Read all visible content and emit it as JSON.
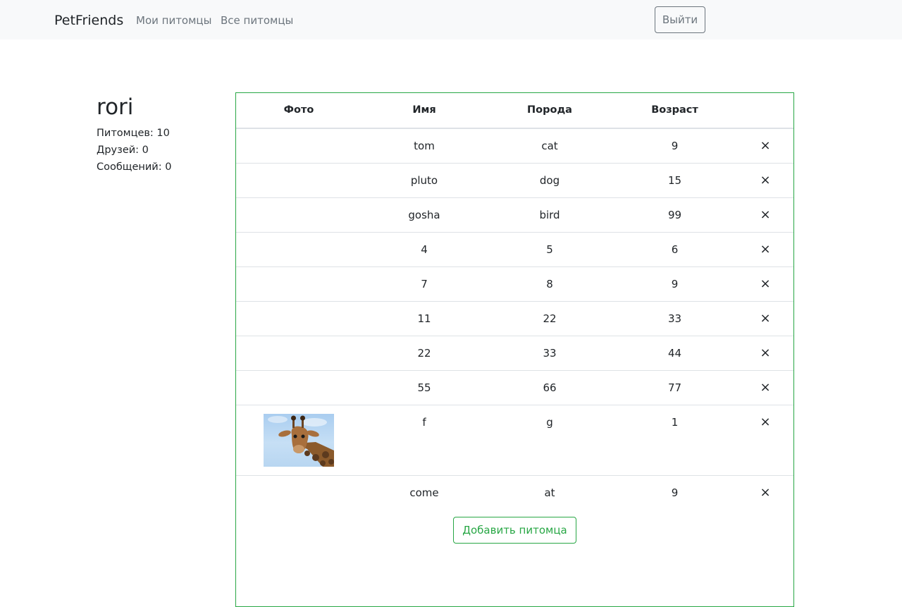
{
  "navbar": {
    "brand": "PetFriends",
    "links": [
      "Мои питомцы",
      "Все питомцы"
    ],
    "logout_label": "Выйти"
  },
  "profile": {
    "username": "rori",
    "pets_count": "Питомцев: 10",
    "friends_count": "Друзей: 0",
    "messages_count": "Сообщений: 0"
  },
  "table": {
    "headers": [
      "Фото",
      "Имя",
      "Порода",
      "Возраст",
      ""
    ],
    "rows": [
      {
        "name": "tom",
        "breed": "cat",
        "age": "9",
        "delete": "×"
      },
      {
        "name": "pluto",
        "breed": "dog",
        "age": "15",
        "delete": "×"
      },
      {
        "name": "gosha",
        "breed": "bird",
        "age": "99",
        "delete": "×"
      },
      {
        "name": "4",
        "breed": "5",
        "age": "6",
        "delete": "×"
      },
      {
        "name": "7",
        "breed": "8",
        "age": "9",
        "delete": "×"
      },
      {
        "name": "11",
        "breed": "22",
        "age": "33",
        "delete": "×"
      },
      {
        "name": "22",
        "breed": "33",
        "age": "44",
        "delete": "×"
      },
      {
        "name": "55",
        "breed": "66",
        "age": "77",
        "delete": "×"
      },
      {
        "name": "f",
        "breed": "g",
        "age": "1",
        "delete": "×"
      },
      {
        "name": "come",
        "breed": "at",
        "age": "9",
        "delete": "×"
      }
    ],
    "add_label": "Добавить питомца"
  },
  "colors": {
    "accent": "#28a745",
    "navbar_bg": "#f8f9fa",
    "muted": "#6c757d"
  }
}
